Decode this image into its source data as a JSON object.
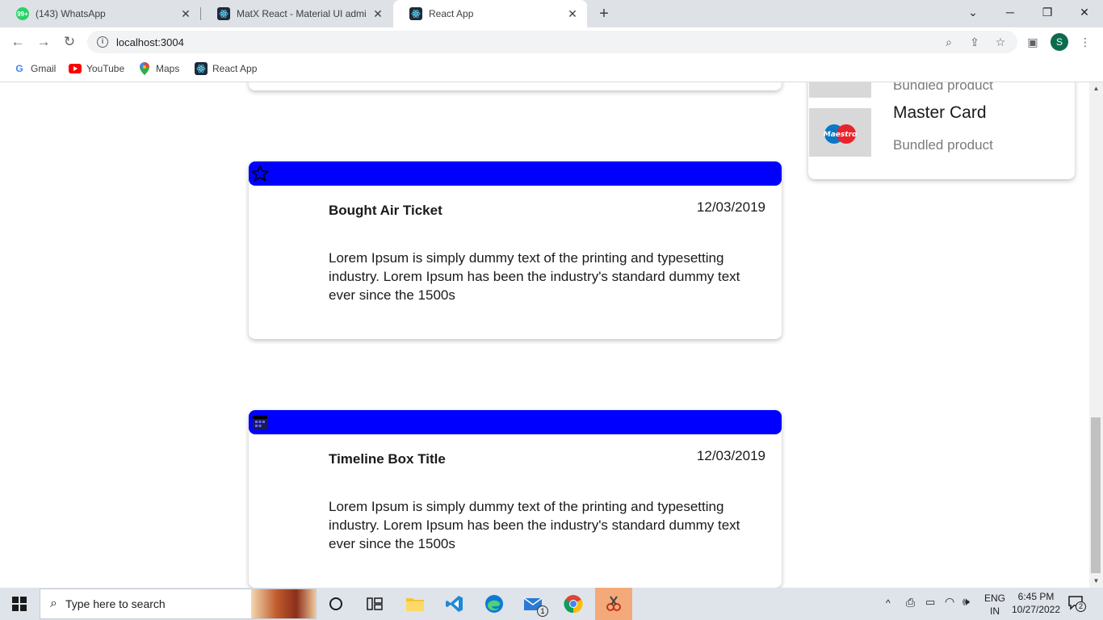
{
  "browser": {
    "tabs": [
      {
        "title": "(143) WhatsApp",
        "badge": "99+",
        "active": false
      },
      {
        "title": "MatX React - Material UI admin d",
        "active": false
      },
      {
        "title": "React App",
        "active": true
      }
    ],
    "new_tab": "+",
    "window_controls": {
      "minimize": "─",
      "restore": "❐",
      "close": "✕",
      "tab_search": "⌄"
    },
    "address": "localhost:3004",
    "profile_initial": "S",
    "bookmarks": [
      {
        "label": "Gmail",
        "icon": "google-icon"
      },
      {
        "label": "YouTube",
        "icon": "youtube-icon"
      },
      {
        "label": "Maps",
        "icon": "maps-icon"
      },
      {
        "label": "React App",
        "icon": "react-icon"
      }
    ]
  },
  "page": {
    "timeline": [
      {
        "icon": "star-icon",
        "title": "Bought Air Ticket",
        "date": "12/03/2019",
        "body": "Lorem Ipsum is simply dummy text of the printing and typesetting industry. Lorem Ipsum has been the industry's standard dummy text ever since the 1500s"
      },
      {
        "icon": "calendar-icon",
        "title": "Timeline Box Title",
        "date": "12/03/2019",
        "body": "Lorem Ipsum is simply dummy text of the printing and typesetting industry. Lorem Ipsum has been the industry's standard dummy text ever since the 1500s"
      }
    ],
    "products": [
      {
        "name": "",
        "subtitle": "Bundled product",
        "logo": "mastercard"
      },
      {
        "name": "Master Card",
        "subtitle": "Bundled product",
        "logo": "Maestro"
      }
    ],
    "accent_color": "#0000ff"
  },
  "taskbar": {
    "search_placeholder": "Type here to search",
    "mail_badge": "1",
    "language": "ENG",
    "region": "IN",
    "time": "6:45 PM",
    "date": "10/27/2022",
    "notifications": "2"
  }
}
